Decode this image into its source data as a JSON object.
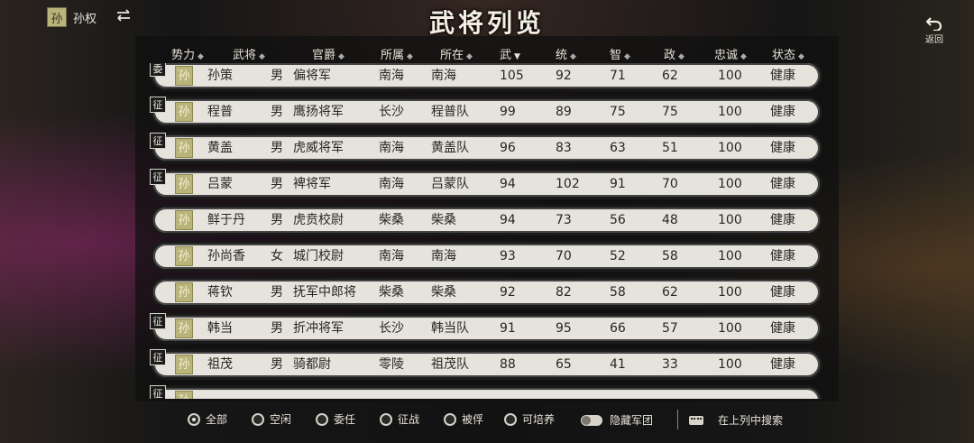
{
  "top": {
    "faction_badge": "孙",
    "faction_name": "孙权",
    "title": "武将列览",
    "back_label": "返回"
  },
  "columns": [
    {
      "label": "势力",
      "sort": true
    },
    {
      "label": "武将",
      "sort": true
    },
    {
      "label": "官爵",
      "sort": true
    },
    {
      "label": "所属",
      "sort": true
    },
    {
      "label": "所在",
      "sort": true
    },
    {
      "label": "武",
      "sort": true,
      "active": true
    },
    {
      "label": "统",
      "sort": true
    },
    {
      "label": "智",
      "sort": true
    },
    {
      "label": "政",
      "sort": true
    },
    {
      "label": "忠诚",
      "sort": true
    },
    {
      "label": "状态",
      "sort": true
    }
  ],
  "rows": [
    {
      "tag": "委",
      "faction": "孙",
      "name": "孙策",
      "gender": "男",
      "rank": "偏将军",
      "belong": "南海",
      "location": "南海",
      "wu": "105",
      "tong": "92",
      "zhi": "71",
      "zheng": "62",
      "loyalty": "100",
      "status": "健康"
    },
    {
      "tag": "征",
      "faction": "孙",
      "name": "程普",
      "gender": "男",
      "rank": "鹰扬将军",
      "belong": "长沙",
      "location": "程普队",
      "wu": "99",
      "tong": "89",
      "zhi": "75",
      "zheng": "75",
      "loyalty": "100",
      "status": "健康"
    },
    {
      "tag": "征",
      "faction": "孙",
      "name": "黄盖",
      "gender": "男",
      "rank": "虎威将军",
      "belong": "南海",
      "location": "黄盖队",
      "wu": "96",
      "tong": "83",
      "zhi": "63",
      "zheng": "51",
      "loyalty": "100",
      "status": "健康"
    },
    {
      "tag": "征",
      "faction": "孙",
      "name": "吕蒙",
      "gender": "男",
      "rank": "裨将军",
      "belong": "南海",
      "location": "吕蒙队",
      "wu": "94",
      "tong": "102",
      "zhi": "91",
      "zheng": "70",
      "loyalty": "100",
      "status": "健康"
    },
    {
      "tag": "",
      "faction": "孙",
      "name": "鲜于丹",
      "gender": "男",
      "rank": "虎贲校尉",
      "belong": "柴桑",
      "location": "柴桑",
      "wu": "94",
      "tong": "73",
      "zhi": "56",
      "zheng": "48",
      "loyalty": "100",
      "status": "健康"
    },
    {
      "tag": "",
      "faction": "孙",
      "name": "孙尚香",
      "gender": "女",
      "rank": "城门校尉",
      "belong": "南海",
      "location": "南海",
      "wu": "93",
      "tong": "70",
      "zhi": "52",
      "zheng": "58",
      "loyalty": "100",
      "status": "健康"
    },
    {
      "tag": "",
      "faction": "孙",
      "name": "蒋钦",
      "gender": "男",
      "rank": "抚军中郎将",
      "belong": "柴桑",
      "location": "柴桑",
      "wu": "92",
      "tong": "82",
      "zhi": "58",
      "zheng": "62",
      "loyalty": "100",
      "status": "健康"
    },
    {
      "tag": "征",
      "faction": "孙",
      "name": "韩当",
      "gender": "男",
      "rank": "折冲将军",
      "belong": "长沙",
      "location": "韩当队",
      "wu": "91",
      "tong": "95",
      "zhi": "66",
      "zheng": "57",
      "loyalty": "100",
      "status": "健康"
    },
    {
      "tag": "征",
      "faction": "孙",
      "name": "祖茂",
      "gender": "男",
      "rank": "骑都尉",
      "belong": "零陵",
      "location": "祖茂队",
      "wu": "88",
      "tong": "65",
      "zhi": "41",
      "zheng": "33",
      "loyalty": "100",
      "status": "健康"
    },
    {
      "tag": "征",
      "faction": "孙",
      "name": "",
      "gender": "",
      "rank": "",
      "belong": "",
      "location": "",
      "wu": "",
      "tong": "",
      "zhi": "",
      "zheng": "",
      "loyalty": "",
      "status": ""
    }
  ],
  "filters": [
    {
      "label": "全部",
      "selected": true
    },
    {
      "label": "空闲",
      "selected": false
    },
    {
      "label": "委任",
      "selected": false
    },
    {
      "label": "征战",
      "selected": false
    },
    {
      "label": "被俘",
      "selected": false
    },
    {
      "label": "可培养",
      "selected": false
    }
  ],
  "toggle_label": "隐藏军团",
  "search_label": "在上列中搜索"
}
